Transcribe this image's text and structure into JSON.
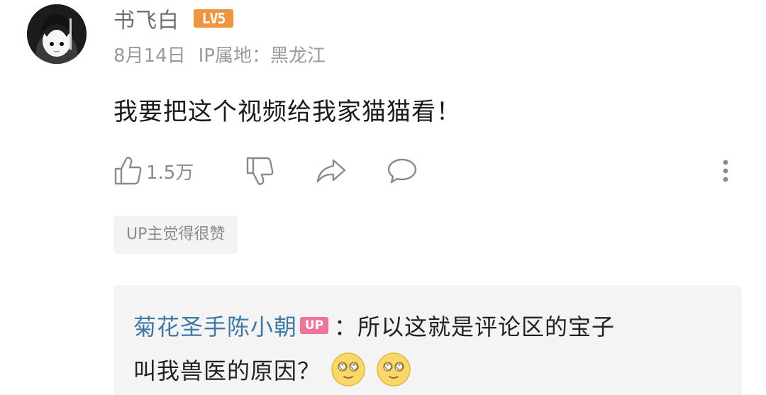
{
  "comment": {
    "username": "书飞白",
    "level_badge": "LV5",
    "date": "8月14日",
    "ip_location": "IP属地：黑龙江",
    "text": "我要把这个视频给我家猫猫看！",
    "like_count": "1.5万",
    "up_liked_tag": "UP主觉得很赞"
  },
  "reply": {
    "username": "菊花圣手陈小朝",
    "up_badge": "UP",
    "text_line1": "：所以这就是评论区的宝子",
    "text_line2": "叫我兽医的原因？",
    "emojis": [
      "dizzy-eyes-emoji",
      "dizzy-eyes-emoji"
    ]
  },
  "icons": [
    "thumbs-up-icon",
    "thumbs-down-icon",
    "share-icon",
    "reply-icon",
    "more-vertical-icon"
  ],
  "colors": {
    "level_badge": "#f0953e",
    "up_badge": "#f0739a",
    "reply_username": "#3e7aa6"
  }
}
